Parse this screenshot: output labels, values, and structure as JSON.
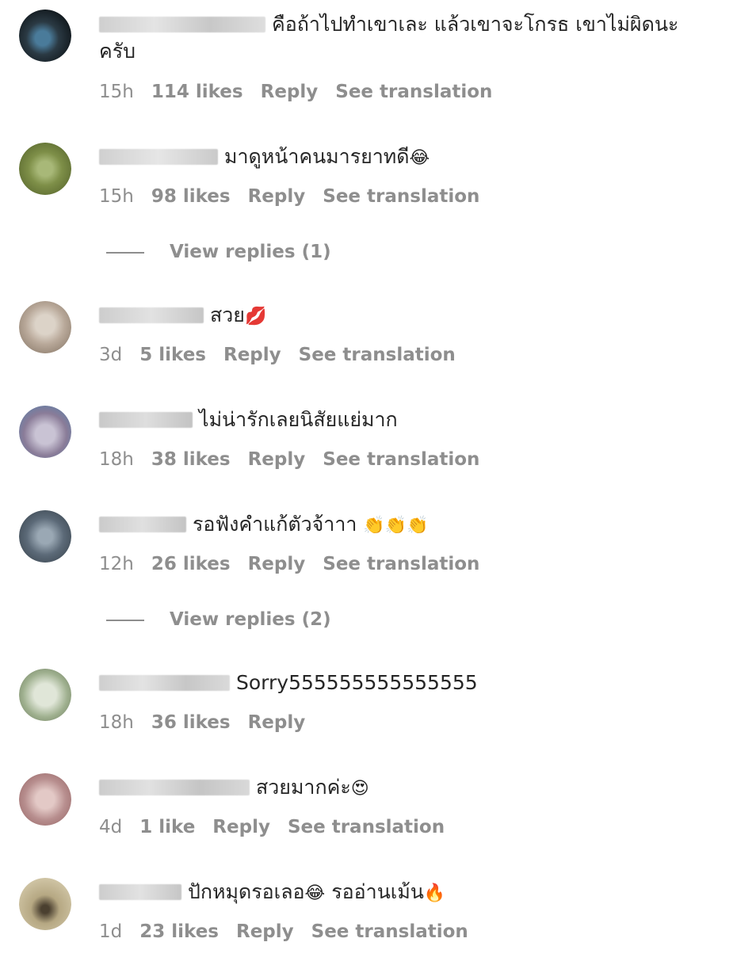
{
  "comments": [
    {
      "text": "คือถ้าไปทำเขาเละ แล้วเขาจะโกรธ เขาไม่ผิดนะครับ",
      "emoji": "",
      "time": "15h",
      "likes": "114 likes",
      "reply": "Reply",
      "translate": "See translation",
      "avatar_colors": [
        "#2b3a44",
        "#4a7b9a",
        "#0e1418"
      ],
      "username_width": 210
    },
    {
      "text": "มาดูหน้าคนมารยาทดี",
      "emoji": "😂",
      "time": "15h",
      "likes": "98 likes",
      "reply": "Reply",
      "translate": "See translation",
      "avatar_colors": [
        "#7e8f48",
        "#a8b878",
        "#5b6a30"
      ],
      "username_width": 150
    },
    {
      "text": "สวย",
      "emoji": "💋",
      "time": "3d",
      "likes": "5 likes",
      "reply": "Reply",
      "translate": "See translation",
      "avatar_colors": [
        "#b9a99a",
        "#dcd3c8",
        "#8a7a6a"
      ],
      "username_width": 132
    },
    {
      "text": "ไม่น่ารักเลยนิสัยแย่มาก",
      "emoji": "",
      "time": "18h",
      "likes": "38 likes",
      "reply": "Reply",
      "translate": "See translation",
      "avatar_colors": [
        "#8a7c98",
        "#c9c3d4",
        "#5d7fa8"
      ],
      "username_width": 118
    },
    {
      "text": "รอฟังคำแก้ตัวจ้าาา",
      "emoji": "👏👏👏",
      "time": "12h",
      "likes": "26 likes",
      "reply": "Reply",
      "translate": "See translation",
      "avatar_colors": [
        "#5c6a78",
        "#9aa8b4",
        "#3b4650"
      ],
      "username_width": 110
    },
    {
      "text": "Sorry555555555555555",
      "emoji": "",
      "time": "18h",
      "likes": "36 likes",
      "reply": "Reply",
      "translate": "",
      "avatar_colors": [
        "#9fb08f",
        "#e0e6d8",
        "#6f7f60"
      ],
      "username_width": 165
    },
    {
      "text": "สวยมากค่ะ",
      "emoji": "😍",
      "time": "4d",
      "likes": "1 like",
      "reply": "Reply",
      "translate": "See translation",
      "avatar_colors": [
        "#b88f8f",
        "#e3c9c6",
        "#9a6a6a"
      ],
      "username_width": 190
    },
    {
      "text": "ปักหมุดรอเลอ",
      "emoji": "😂",
      "text2": " รออ่านเม้น",
      "emoji2": "🔥",
      "time": "1d",
      "likes": "23 likes",
      "reply": "Reply",
      "translate": "See translation",
      "avatar_colors": [
        "#b6a883",
        "#d8ceb0",
        "#4b4030"
      ],
      "username_width": 104
    }
  ],
  "view_replies": [
    "View replies (1)",
    "View replies (2)"
  ],
  "colors": {
    "text": "#262626",
    "meta": "#8e8e8e",
    "background": "#ffffff"
  }
}
